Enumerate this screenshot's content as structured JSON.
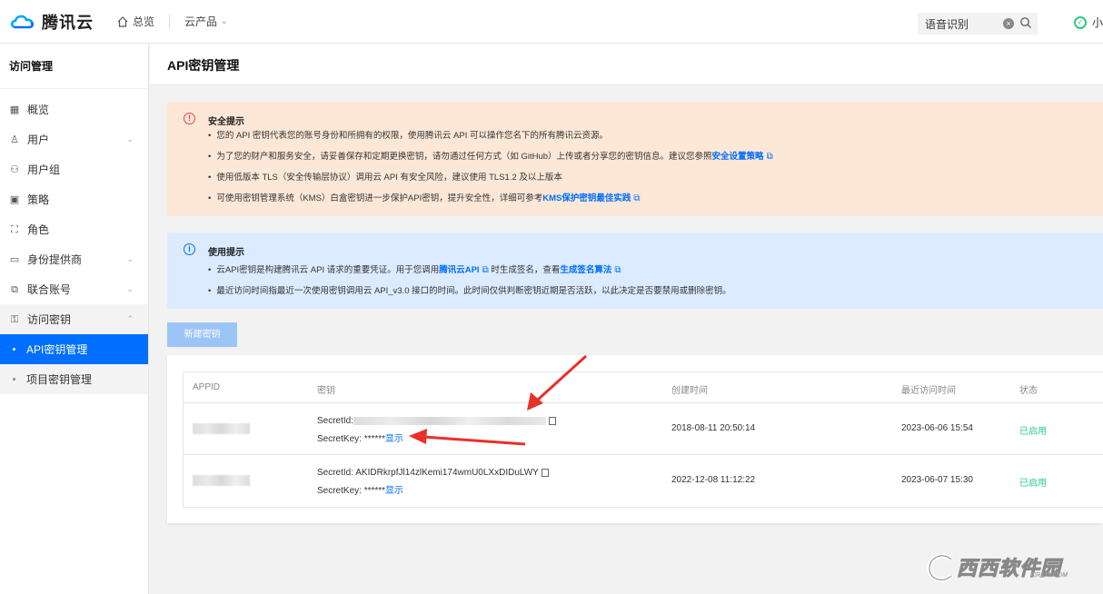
{
  "topbar": {
    "brand": "腾讯云",
    "home_label": "总览",
    "products_label": "云产品",
    "search_value": "语音识别",
    "user_initial": "小"
  },
  "sidebar": {
    "title": "访问管理",
    "items": [
      {
        "label": "概览",
        "icon": "grid-icon"
      },
      {
        "label": "用户",
        "icon": "user-icon",
        "expandable": true
      },
      {
        "label": "用户组",
        "icon": "user-group-icon"
      },
      {
        "label": "策略",
        "icon": "policy-icon"
      },
      {
        "label": "角色",
        "icon": "role-icon"
      },
      {
        "label": "身份提供商",
        "icon": "idp-icon",
        "expandable": true
      },
      {
        "label": "联合账号",
        "icon": "federated-icon",
        "expandable": true
      },
      {
        "label": "访问密钥",
        "icon": "key-icon",
        "expanded": true
      }
    ],
    "subitems": [
      {
        "label": "API密钥管理",
        "active": true
      },
      {
        "label": "项目密钥管理",
        "active": false
      }
    ]
  },
  "page": {
    "title": "API密钥管理"
  },
  "security_notice": {
    "title": "安全提示",
    "items": [
      {
        "text": "您的 API 密钥代表您的账号身份和所拥有的权限，使用腾讯云 API 可以操作您名下的所有腾讯云资源。"
      },
      {
        "text": "为了您的财产和服务安全，请妥善保存和定期更换密钥，请勿通过任何方式（如 GitHub）上传或者分享您的密钥信息。建议您参照",
        "link": "安全设置策略"
      },
      {
        "text": "使用低版本 TLS（安全传输层协议）调用云 API 有安全风险，建议使用 TLS1.2 及以上版本"
      },
      {
        "text": "可使用密钥管理系统（KMS）白盒密钥进一步保护API密钥，提升安全性，详细可参考",
        "link": "KMS保护密钥最佳实践"
      }
    ]
  },
  "usage_notice": {
    "title": "使用提示",
    "item1_a": "云API密钥是构建腾讯云 API 请求的重要凭证。用于您调用",
    "item1_link1": "腾讯云API",
    "item1_b": "时生成签名，查看",
    "item1_link2": "生成签名算法",
    "item2": "最近访问时间指最近一次使用密钥调用云 API_v3.0 接口的时间。此时间仅供判断密钥近期是否活跃，以此决定是否要禁用或删除密钥。"
  },
  "new_key_button": "新建密钥",
  "table": {
    "headers": [
      "APPID",
      "密钥",
      "创建时间",
      "最近访问时间",
      "状态"
    ],
    "rows": [
      {
        "secret_id_label": "SecretId:",
        "secret_id": "",
        "secret_key_label": "SecretKey: ******",
        "show_label": "显示",
        "created": "2018-08-11 20:50:14",
        "last_access": "2023-06-06 15:54",
        "status": "已启用"
      },
      {
        "secret_id_label": "SecretId:",
        "secret_id": "AKIDRkrpfJl14zlKemi174wmU0LXxDIDuLWY",
        "secret_key_label": "SecretKey: ******",
        "show_label": "显示",
        "created": "2022-12-08 11:12:22",
        "last_access": "2023-06-07 15:30",
        "status": "已启用"
      }
    ]
  },
  "watermark": {
    "text": "西西软件园",
    "sub": "CR173.COM"
  },
  "colors": {
    "accent": "#006eff",
    "warn_bg": "#fde8d8",
    "info_bg": "#dcebff",
    "enabled": "#29cc85",
    "annotation_arrow": "#e8302a"
  }
}
